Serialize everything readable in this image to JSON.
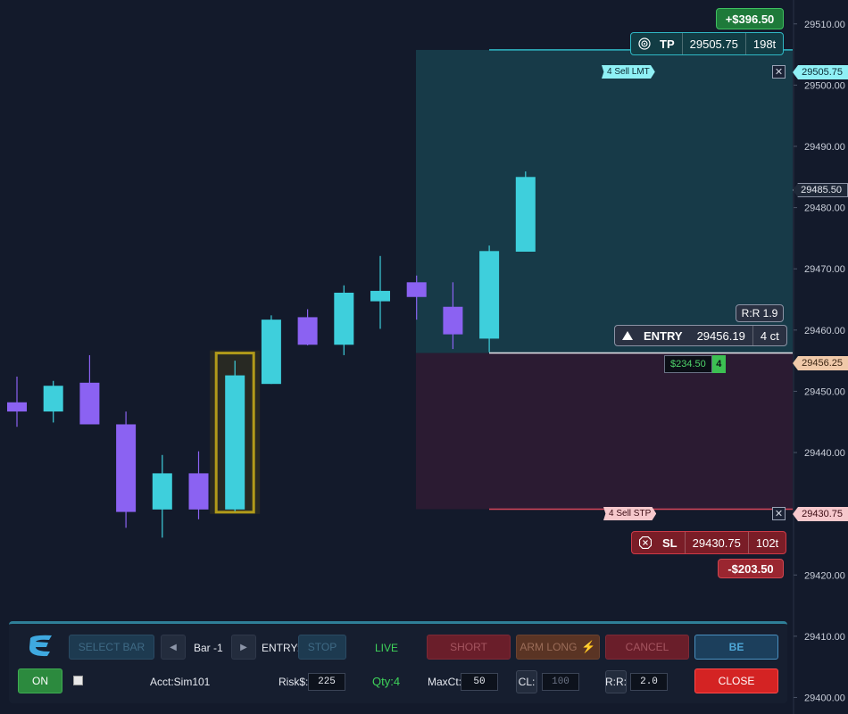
{
  "colors": {
    "background": "#131a2b",
    "bull": "#3ecfdc",
    "bear": "#8b62f2",
    "tp_zone": "#173a48",
    "sl_zone": "#2b1b32",
    "tp_line": "#2fb7c4",
    "sl_line": "#d6465a",
    "entry_line": "#e8e9ee",
    "highlight": "#b19a1a"
  },
  "chart_data": {
    "type": "candlestick",
    "y_axis_ticks": [
      "29510.00",
      "29500.00",
      "29490.00",
      "29480.00",
      "29470.00",
      "29460.00",
      "29450.00",
      "29440.00",
      "29430.00",
      "29420.00",
      "29410.00",
      "29400.00"
    ],
    "ylim": [
      29397.3,
      29513.9
    ],
    "candles": [
      {
        "open": 29448.2,
        "high": 29452.4,
        "low": 29444.2,
        "close": 29446.7,
        "dir": "bear"
      },
      {
        "open": 29446.7,
        "high": 29451.7,
        "low": 29444.9,
        "close": 29450.9,
        "dir": "bull"
      },
      {
        "open": 29451.4,
        "high": 29455.9,
        "low": 29444.7,
        "close": 29444.6,
        "dir": "bear"
      },
      {
        "open": 29444.6,
        "high": 29446.7,
        "low": 29427.7,
        "close": 29430.3,
        "dir": "bear"
      },
      {
        "open": 29430.7,
        "high": 29439.6,
        "low": 29426.1,
        "close": 29436.6,
        "dir": "bull"
      },
      {
        "open": 29436.6,
        "high": 29440.2,
        "low": 29429.1,
        "close": 29430.7,
        "dir": "bear"
      },
      {
        "open": 29430.7,
        "high": 29455.0,
        "low": 29430.4,
        "close": 29452.6,
        "dir": "bull",
        "highlighted": true
      },
      {
        "open": 29451.2,
        "high": 29462.4,
        "low": 29451.2,
        "close": 29461.7,
        "dir": "bull"
      },
      {
        "open": 29462.1,
        "high": 29463.4,
        "low": 29457.5,
        "close": 29457.6,
        "dir": "bear"
      },
      {
        "open": 29457.6,
        "high": 29467.3,
        "low": 29455.9,
        "close": 29466.1,
        "dir": "bull"
      },
      {
        "open": 29464.7,
        "high": 29472.1,
        "low": 29460.2,
        "close": 29466.4,
        "dir": "bull"
      },
      {
        "open": 29467.8,
        "high": 29468.9,
        "low": 29461.7,
        "close": 29465.4,
        "dir": "bear"
      },
      {
        "open": 29463.8,
        "high": 29467.8,
        "low": 29456.9,
        "close": 29459.3,
        "dir": "bear"
      },
      {
        "open": 29458.6,
        "high": 29473.8,
        "low": 29456.4,
        "close": 29472.9,
        "dir": "bull"
      },
      {
        "open": 29472.8,
        "high": 29485.9,
        "low": 29472.8,
        "close": 29485.0,
        "dir": "bull"
      }
    ],
    "tp_price": 29505.75,
    "entry_price": 29456.25,
    "sl_price": 29430.75,
    "current_price": 29485.5
  },
  "tp_pnl": "+$396.50",
  "tp_box": {
    "label": "TP",
    "price": "29505.75",
    "ticks": "198t"
  },
  "tp_order_tag": "4  Sell LMT",
  "sl_order_tag": "4  Sell STP",
  "close_x": "✕",
  "price_tags": {
    "tp": "29505.75",
    "current": "29485.50",
    "entry": "29456.25",
    "sl": "29430.75"
  },
  "rr_badge": "R:R 1.9",
  "entry_box": {
    "label": "ENTRY",
    "price": "29456.19",
    "contracts": "4 ct"
  },
  "entry_pnl": {
    "value": "$234.50",
    "qty": "4"
  },
  "sl_box": {
    "label": "SL",
    "price": "29430.75",
    "ticks": "102t"
  },
  "sl_pnl": "-$203.50",
  "panel": {
    "select_bar": "SELECT BAR",
    "bar_label": "Bar -1",
    "entry_label": "ENTRY:",
    "stop_btn": "STOP",
    "live": "LIVE",
    "short_btn": "SHORT",
    "arm_long_btn": "ARM LONG",
    "cancel_btn": "CANCEL",
    "be_btn": "BE",
    "on_btn": "ON",
    "account": "Acct:Sim101",
    "risk_label": "Risk$:",
    "risk_value": "225",
    "qty": "Qty:4",
    "maxct_label": "MaxCt:",
    "maxct_value": "50",
    "cl_label": "CL:",
    "cl_value": "100",
    "rr_label": "R:R:",
    "rr_value": "2.0",
    "close_btn": "CLOSE"
  }
}
